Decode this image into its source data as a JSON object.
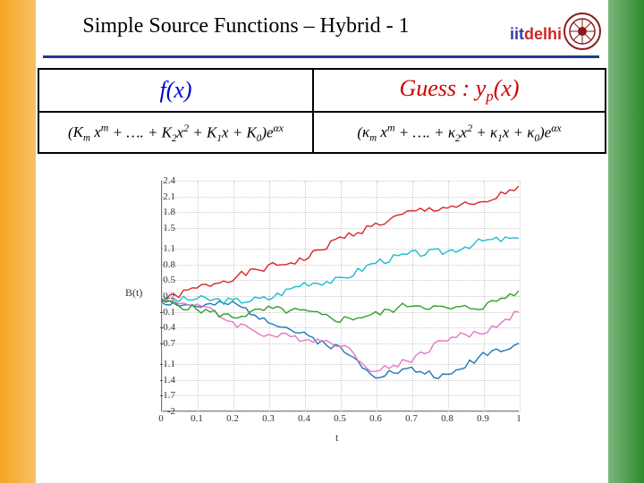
{
  "title": "Simple Source Functions – Hybrid - 1",
  "brand": {
    "iit": "iit",
    "delhi": "delhi"
  },
  "table": {
    "head_fx": "f(x)",
    "head_guess": "Guess : yₚ(x)",
    "fx_expr": "(K_m x^m + …. + K_2 x^2 + K_1 x + K_0) e^{αx}",
    "guess_expr": "(κ_m x^m + …. + κ_2 x^2 + κ_1 x + κ_0) e^{αx}"
  },
  "chart_data": {
    "type": "line",
    "title": "",
    "xlabel": "t",
    "ylabel": "B(t)",
    "xlim": [
      0,
      1
    ],
    "ylim": [
      -2,
      2.4
    ],
    "yticks": [
      -2,
      -1.7,
      -1.4,
      -1.1,
      -0.7,
      -0.4,
      -0.1,
      0.2,
      0.5,
      0.8,
      1.1,
      1.5,
      1.8,
      2.1,
      2.4
    ],
    "xticks": [
      0,
      0.1,
      0.2,
      0.3,
      0.4,
      0.5,
      0.6,
      0.7,
      0.8,
      0.9,
      1
    ],
    "series": [
      {
        "name": "red",
        "color": "#d62728",
        "values": [
          0.1,
          0.35,
          0.55,
          0.75,
          0.9,
          1.3,
          1.55,
          1.8,
          1.9,
          1.95,
          2.3
        ]
      },
      {
        "name": "blue",
        "color": "#1f77b4",
        "values": [
          0.1,
          0.0,
          0.05,
          -0.25,
          -0.55,
          -0.8,
          -1.3,
          -1.2,
          -1.35,
          -0.9,
          -0.7
        ]
      },
      {
        "name": "cyan",
        "color": "#17becf",
        "values": [
          0.1,
          0.15,
          0.1,
          0.15,
          0.45,
          0.5,
          0.85,
          1.0,
          1.05,
          1.25,
          1.3
        ]
      },
      {
        "name": "magenta",
        "color": "#e377c2",
        "values": [
          0.1,
          0.05,
          -0.3,
          -0.55,
          -0.6,
          -0.7,
          -1.25,
          -1.0,
          -0.6,
          -0.5,
          -0.1
        ]
      },
      {
        "name": "green",
        "color": "#2ca02c",
        "values": [
          0.1,
          -0.05,
          -0.2,
          -0.05,
          -0.1,
          -0.25,
          -0.15,
          0.05,
          -0.05,
          0.0,
          0.3
        ]
      }
    ]
  }
}
